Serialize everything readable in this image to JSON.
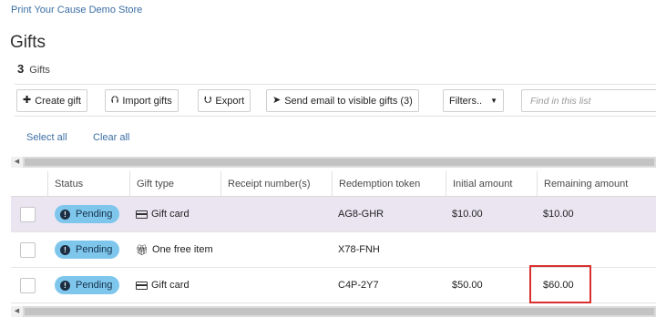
{
  "store_name": "Print Your Cause Demo Store",
  "page_title": "Gifts",
  "gift_count": "3",
  "gift_count_label": "Gifts",
  "toolbar": {
    "create_label": "Create gift",
    "import_label": "Import gifts",
    "export_label": "Export",
    "send_email_label": "Send email to visible gifts (3)",
    "filters_label": "Filters..",
    "find_placeholder": "Find in this list"
  },
  "selection": {
    "select_all": "Select all",
    "clear_all": "Clear all"
  },
  "table": {
    "columns": [
      "Status",
      "Gift type",
      "Receipt number(s)",
      "Redemption token",
      "Initial amount",
      "Remaining amount"
    ],
    "rows": [
      {
        "status": "Pending",
        "gift_type": "Gift card",
        "gift_icon": "credit-card-icon",
        "receipt": "",
        "token": "AG8-GHR",
        "initial": "$10.00",
        "remaining": "$10.00"
      },
      {
        "status": "Pending",
        "gift_type": "One free item",
        "gift_icon": "gift-icon",
        "receipt": "",
        "token": "X78-FNH",
        "initial": "",
        "remaining": ""
      },
      {
        "status": "Pending",
        "gift_type": "Gift card",
        "gift_icon": "credit-card-icon",
        "receipt": "",
        "token": "C4P-2Y7",
        "initial": "$50.00",
        "remaining": "$60.00"
      }
    ]
  },
  "colors": {
    "link": "#3b6ea5",
    "badge": "#7fc6ec",
    "highlight_row": "#eae5f1",
    "annotation_box": "#d9302f"
  }
}
